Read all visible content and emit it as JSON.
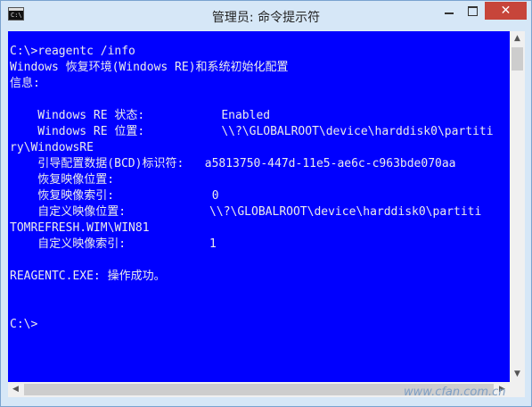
{
  "window": {
    "title": "管理员: 命令提示符",
    "icon_glyph": "C:\\",
    "close_glyph": "✕"
  },
  "console": {
    "lines": [
      "C:\\>reagentc /info",
      "Windows 恢复环境(Windows RE)和系统初始化配置",
      "信息:",
      "",
      "    Windows RE 状态:           Enabled",
      "    Windows RE 位置:           \\\\?\\GLOBALROOT\\device\\harddisk0\\partiti",
      "ry\\WindowsRE",
      "    引导配置数据(BCD)标识符:   a5813750-447d-11e5-ae6c-c963bde070aa",
      "    恢复映像位置:",
      "    恢复映像索引:              0",
      "    自定义映像位置:            \\\\?\\GLOBALROOT\\device\\harddisk0\\partiti",
      "TOMREFRESH.WIM\\WIN81",
      "    自定义映像索引:            1",
      "",
      "REAGENTC.EXE: 操作成功。",
      "",
      "",
      "C:\\>"
    ]
  },
  "watermark": "www.cfan.com.cn",
  "colors": {
    "console_background": "#0000ff",
    "console_text": "#ececec",
    "close_button": "#c7453a"
  },
  "icons": {
    "minimize": "minimize-icon",
    "maximize": "maximize-icon",
    "close": "close-icon",
    "scroll_up": "arrow-up-icon",
    "scroll_down": "arrow-down-icon",
    "scroll_left": "arrow-left-icon",
    "scroll_right": "arrow-right-icon"
  }
}
